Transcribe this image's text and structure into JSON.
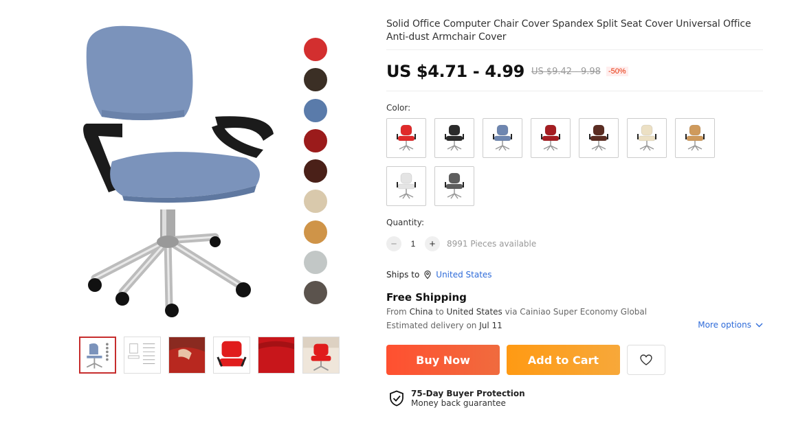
{
  "product": {
    "title": "Solid Office Computer Chair Cover Spandex Split Seat Cover Universal Office Anti-dust Armchair Cover",
    "price": "US $4.71 - 4.99",
    "old_price": "US $9.42 - 9.98",
    "discount": "-50%"
  },
  "gallery": {
    "swatches": [
      "#d32f2f",
      "#3b2f25",
      "#5a7baa",
      "#9b1b1b",
      "#4a2018",
      "#d9c9ac",
      "#cf9448",
      "#c2c7c6",
      "#5b534d"
    ],
    "thumbnails": [
      "thumb-blue-chair",
      "thumb-size-chart",
      "thumb-hand-install",
      "thumb-red-cover",
      "thumb-red-closeup",
      "thumb-red-chair-room"
    ]
  },
  "color": {
    "label": "Color:",
    "options": [
      {
        "name": "red",
        "hex": "#e02a2a"
      },
      {
        "name": "black",
        "hex": "#2b2b2b"
      },
      {
        "name": "blue",
        "hex": "#6e86b0"
      },
      {
        "name": "wine",
        "hex": "#a51d22"
      },
      {
        "name": "brown",
        "hex": "#5b2d22"
      },
      {
        "name": "beige",
        "hex": "#ece0c4"
      },
      {
        "name": "camel",
        "hex": "#cf9a5c"
      },
      {
        "name": "white",
        "hex": "#e4e4e4"
      },
      {
        "name": "gray",
        "hex": "#5e5e5e"
      }
    ]
  },
  "quantity": {
    "label": "Quantity:",
    "minus": "−",
    "value": "1",
    "plus": "+",
    "available": "8991 Pieces available"
  },
  "shipping": {
    "ships_to_label": "Ships to",
    "ships_to_country": "United States",
    "title": "Free Shipping",
    "from_prefix": "From",
    "from_country": "China",
    "to_word": "to",
    "to_country": "United States",
    "via": "via Cainiao Super Economy Global",
    "delivery_prefix": "Estimated delivery on",
    "delivery_date": "Jul 11",
    "more_options": "More options"
  },
  "actions": {
    "buy_now": "Buy Now",
    "add_to_cart": "Add to Cart"
  },
  "protection": {
    "title": "75-Day Buyer Protection",
    "subtitle": "Money back guarantee"
  }
}
